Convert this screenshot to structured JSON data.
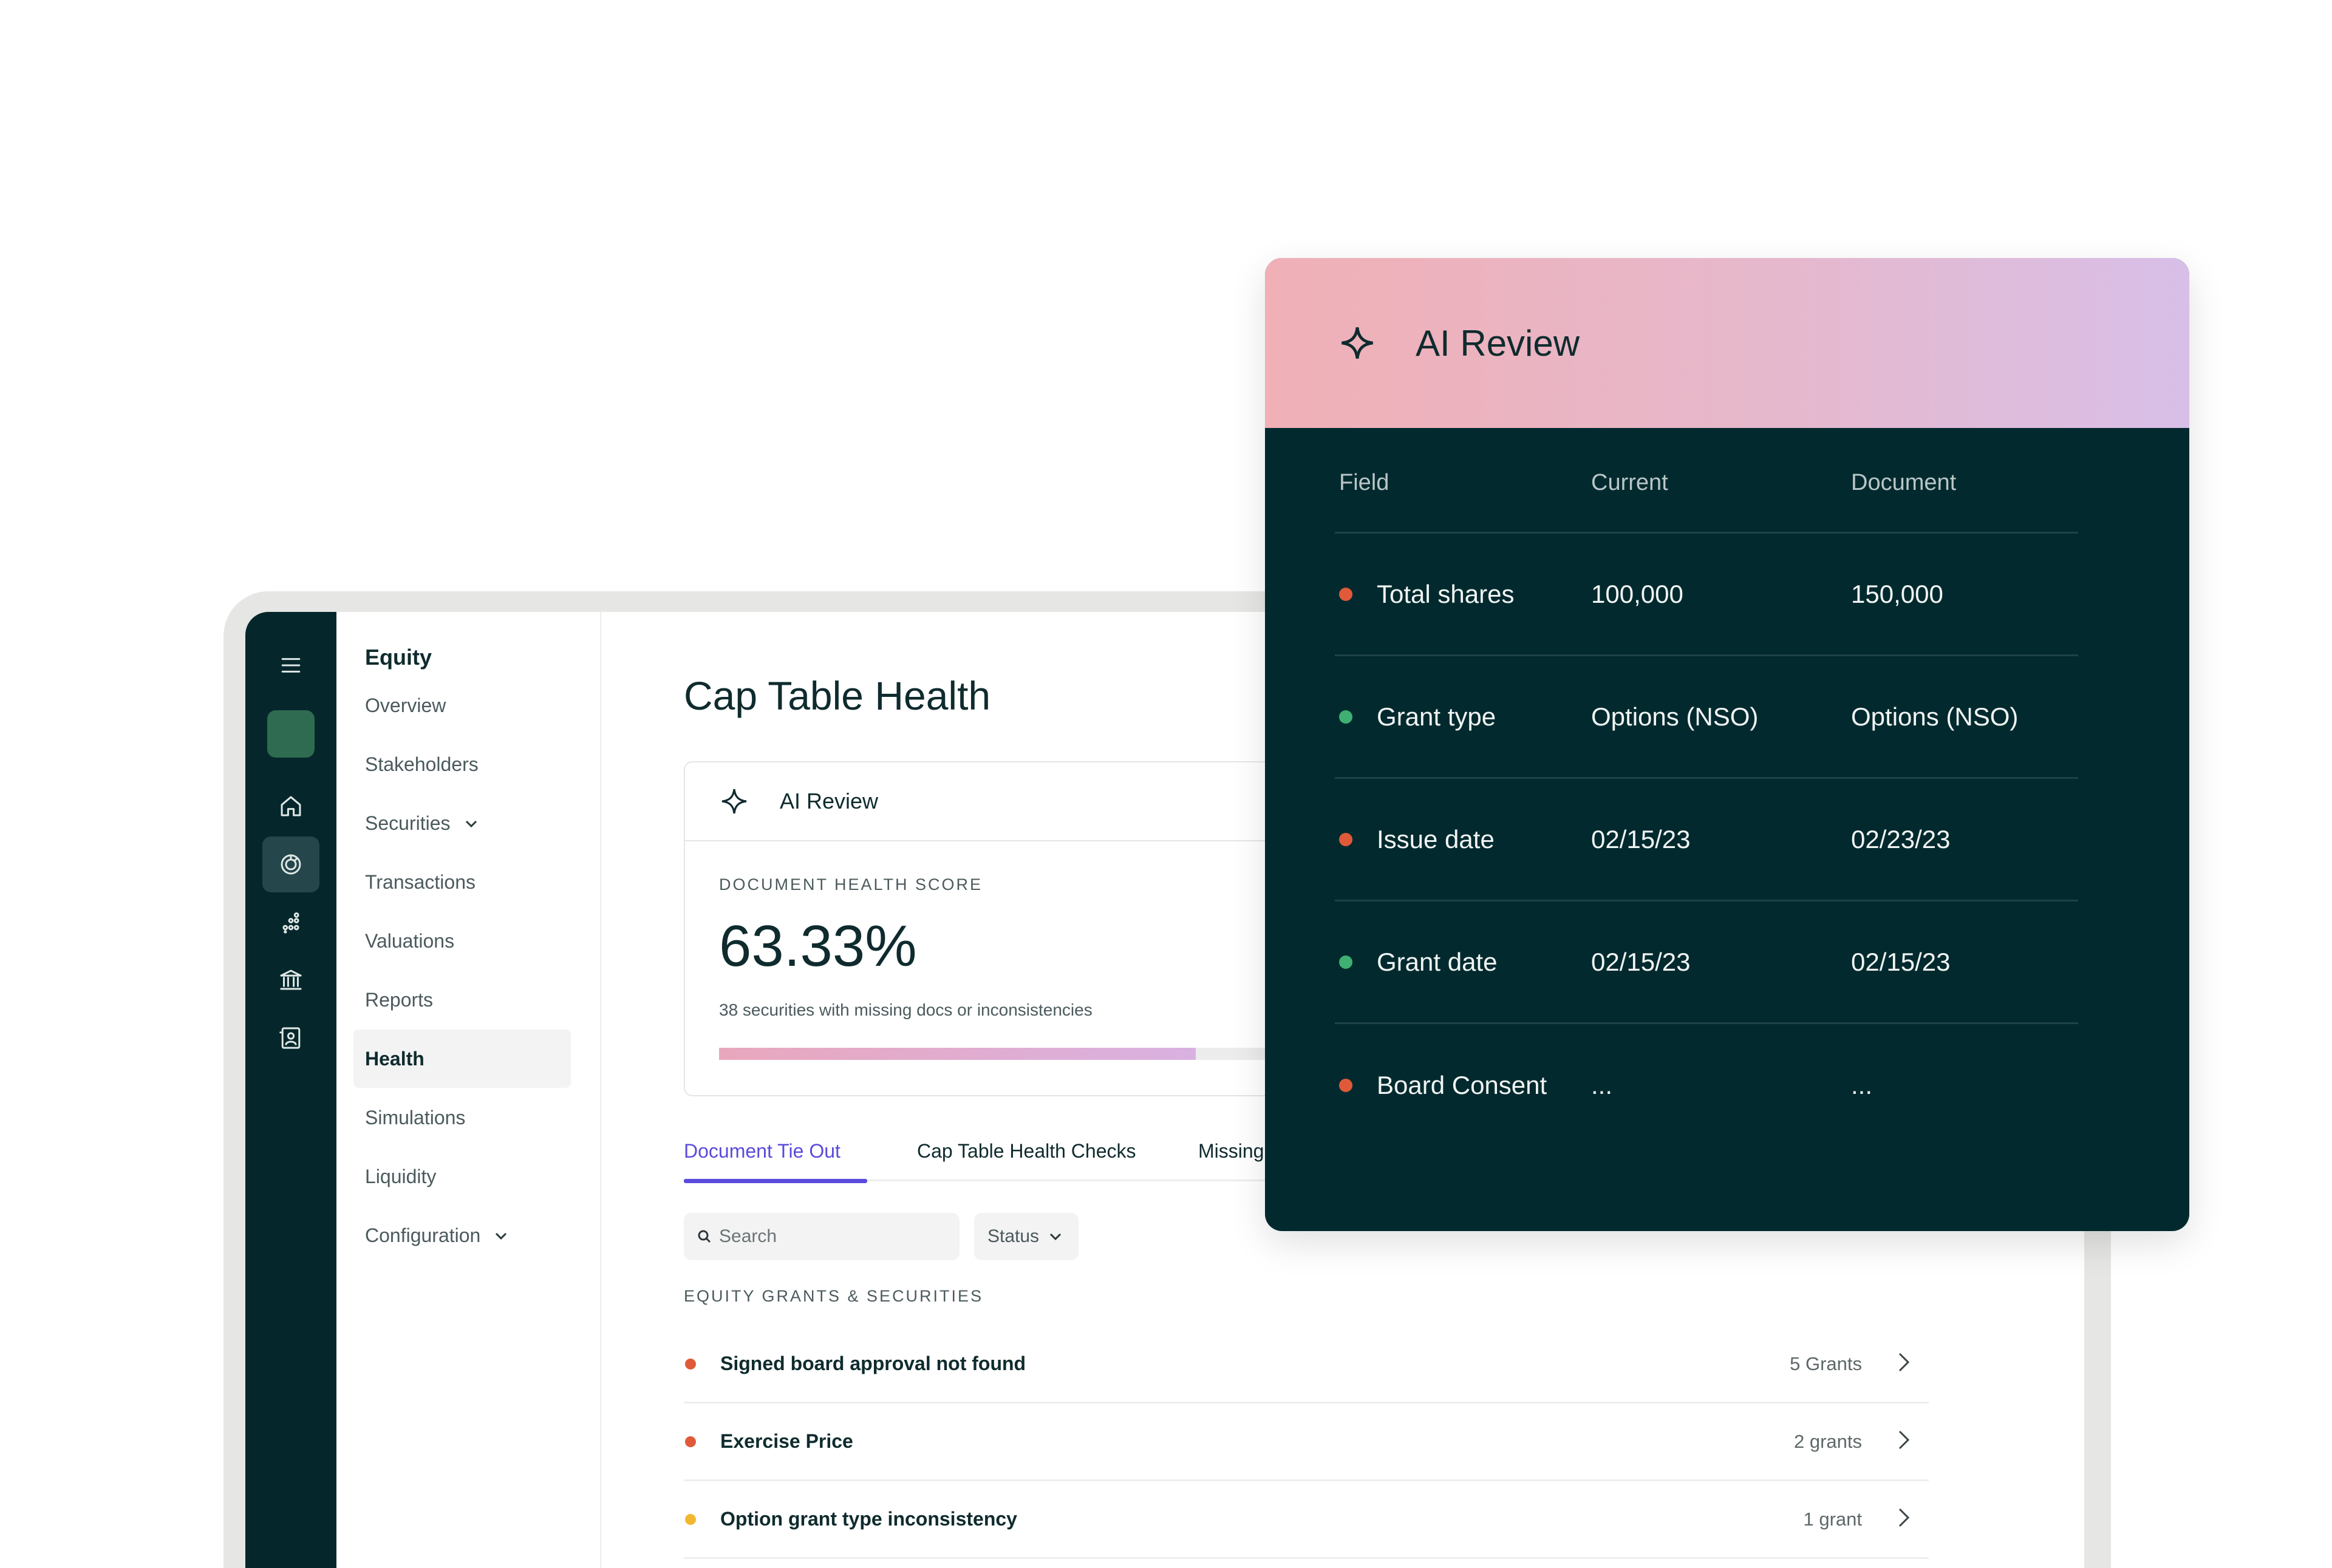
{
  "colors": {
    "rail_bg": "#05272b",
    "accent": "#5a4bdc",
    "red": "#e05a3a",
    "green": "#3fb071",
    "yellow": "#f2b731",
    "ai_panel_bg": "#022a2e"
  },
  "rail": {
    "icons": [
      "menu-icon",
      "workspace-logo",
      "home-icon",
      "equity-icon",
      "dots-chart-icon",
      "bank-icon",
      "contacts-icon"
    ]
  },
  "subnav": {
    "heading": "Equity",
    "items": [
      {
        "label": "Overview"
      },
      {
        "label": "Stakeholders"
      },
      {
        "label": "Securities"
      },
      {
        "label": "Transactions"
      },
      {
        "label": "Valuations"
      },
      {
        "label": "Reports"
      },
      {
        "label": "Health"
      },
      {
        "label": "Simulations"
      },
      {
        "label": "Liquidity"
      },
      {
        "label": "Configuration"
      }
    ]
  },
  "main": {
    "title": "Cap Table Health",
    "ai_card": {
      "title": "AI Review",
      "score_label": "DOCUMENT HEALTH SCORE",
      "score_value": "63.33%",
      "score_progress": 0.6333,
      "subtitle": "38 securities with missing docs or inconsistencies"
    },
    "tabs": [
      {
        "label": "Document Tie Out"
      },
      {
        "label": "Cap Table Health Checks"
      },
      {
        "label": "Missing"
      }
    ],
    "search_placeholder": "Search",
    "status_filter": "Status",
    "section_label": "EQUITY GRANTS & SECURITIES",
    "issues": [
      {
        "title": "Signed board approval not found",
        "count": "5 Grants",
        "severity": "red"
      },
      {
        "title": "Exercise Price",
        "count": "2 grants",
        "severity": "red"
      },
      {
        "title": "Option grant type inconsistency",
        "count": "1 grant",
        "severity": "yellow"
      }
    ]
  },
  "ai_panel": {
    "title": "AI Review",
    "columns": [
      "Field",
      "Current",
      "Document"
    ],
    "rows": [
      {
        "field": "Total shares",
        "current": "100,000",
        "document": "150,000",
        "status": "red"
      },
      {
        "field": "Grant type",
        "current": "Options (NSO)",
        "document": "Options (NSO)",
        "status": "green"
      },
      {
        "field": "Issue date",
        "current": "02/15/23",
        "document": "02/23/23",
        "status": "red"
      },
      {
        "field": "Grant date",
        "current": "02/15/23",
        "document": "02/15/23",
        "status": "green"
      },
      {
        "field": "Board Consent",
        "current": "...",
        "document": "...",
        "status": "red"
      }
    ]
  }
}
